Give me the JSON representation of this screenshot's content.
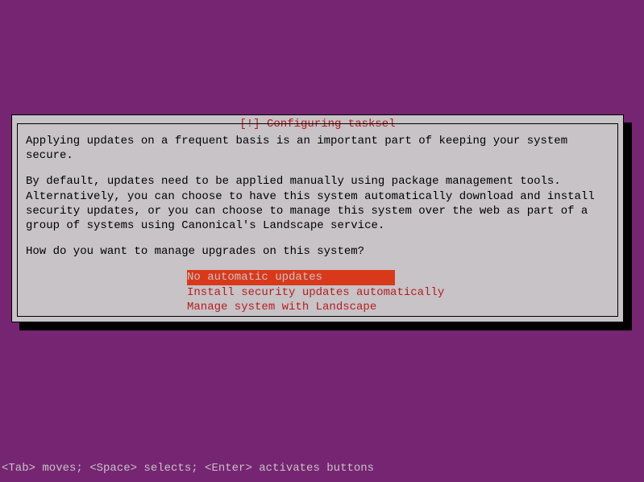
{
  "dialog": {
    "title": "[!] Configuring tasksel",
    "paragraph1": "Applying updates on a frequent basis is an important part of keeping your system secure.",
    "paragraph2": "By default, updates need to be applied manually using package management tools. Alternatively, you can choose to have this system automatically download and install security updates, or you can choose to manage this system over the web as part of a group of systems using Canonical's Landscape service.",
    "prompt": "How do you want to manage upgrades on this system?",
    "options": [
      {
        "label": "No automatic updates",
        "selected": true
      },
      {
        "label": "Install security updates automatically",
        "selected": false
      },
      {
        "label": "Manage system with Landscape",
        "selected": false
      }
    ]
  },
  "footer": {
    "hint": "<Tab> moves; <Space> selects; <Enter> activates buttons"
  }
}
